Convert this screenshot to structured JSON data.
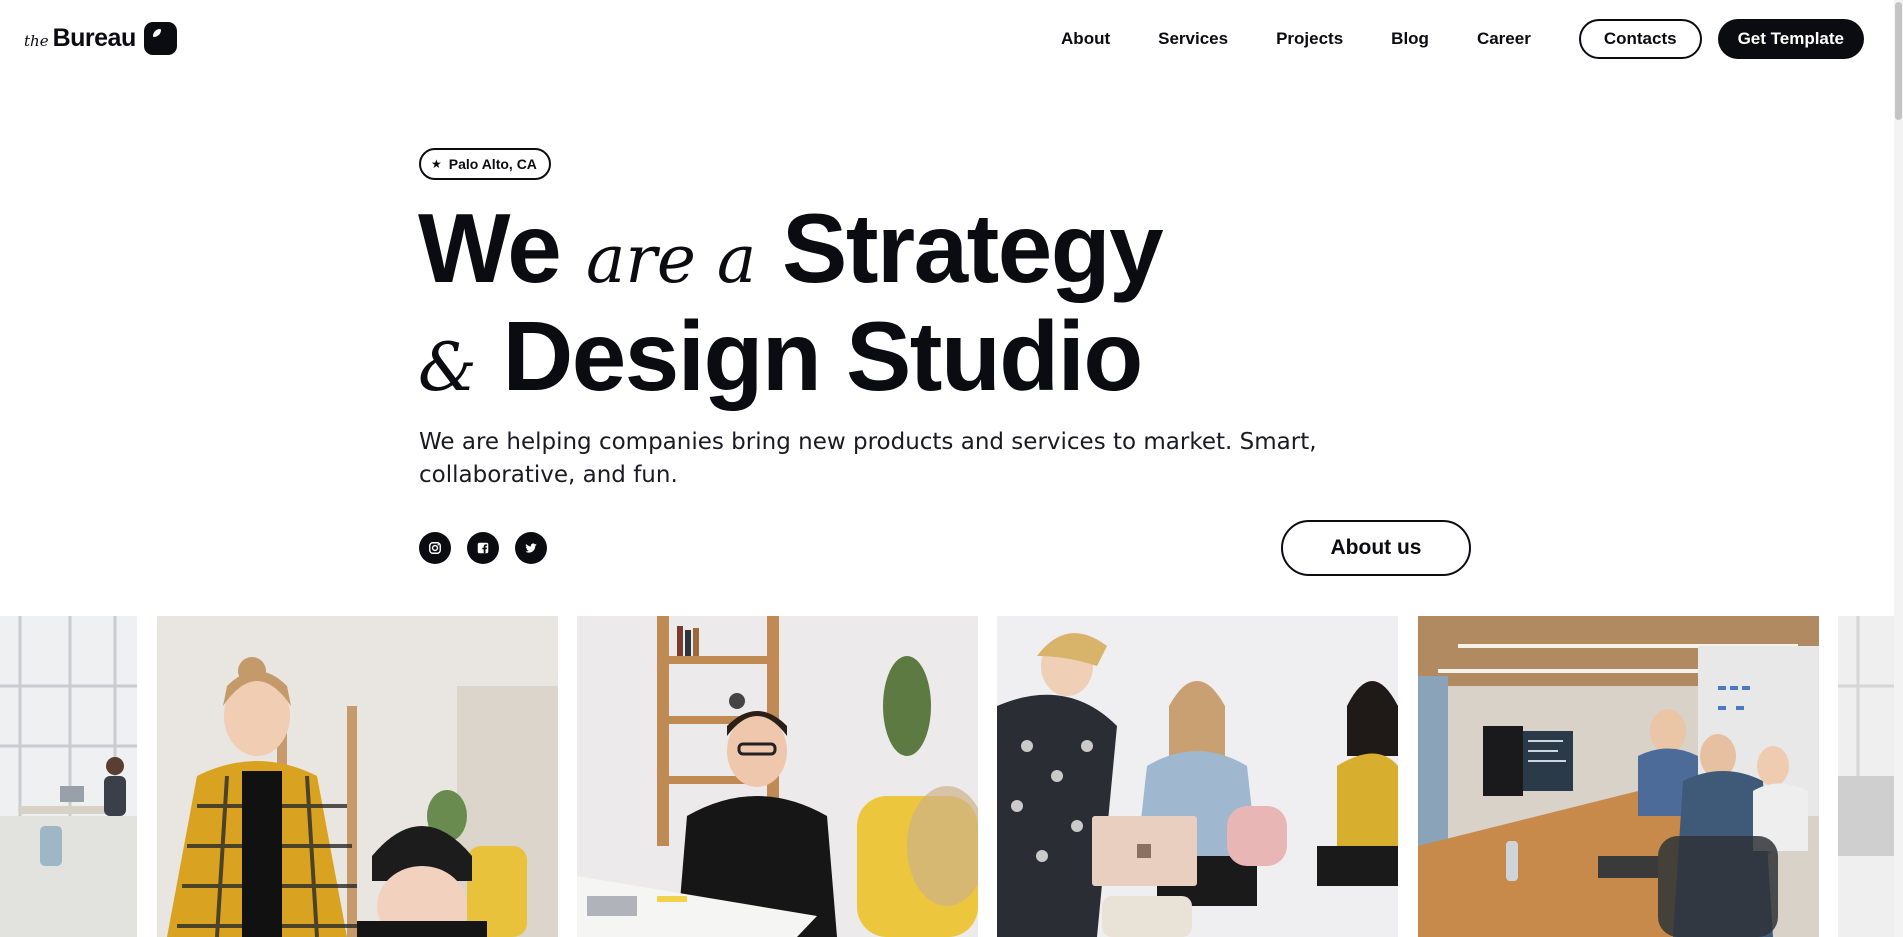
{
  "brand": {
    "prefix": "the",
    "name": "Bureau"
  },
  "nav": {
    "links": [
      "About",
      "Services",
      "Projects",
      "Blog",
      "Career"
    ],
    "contacts_label": "Contacts",
    "cta_label": "Get Template"
  },
  "hero": {
    "location": "Palo Alto, CA",
    "headline": {
      "l1_a": "We",
      "l1_b": "are a",
      "l1_c": "Strategy",
      "l2_a": "&",
      "l2_b": "Design Studio"
    },
    "lead": "We are helping companies bring new products and services to market. Smart, collaborative, and fun.",
    "about_label": "About us"
  },
  "socials": [
    "instagram-icon",
    "facebook-icon",
    "twitter-icon"
  ],
  "gallery": {
    "photos": [
      "office-interior-photo",
      "woman-in-plaid-jacket-photo",
      "smiling-man-at-desk-photo",
      "team-meeting-photo",
      "open-office-photo",
      "partial-office-photo"
    ]
  },
  "colors": {
    "ink": "#0b0b12",
    "background": "#ffffff"
  }
}
